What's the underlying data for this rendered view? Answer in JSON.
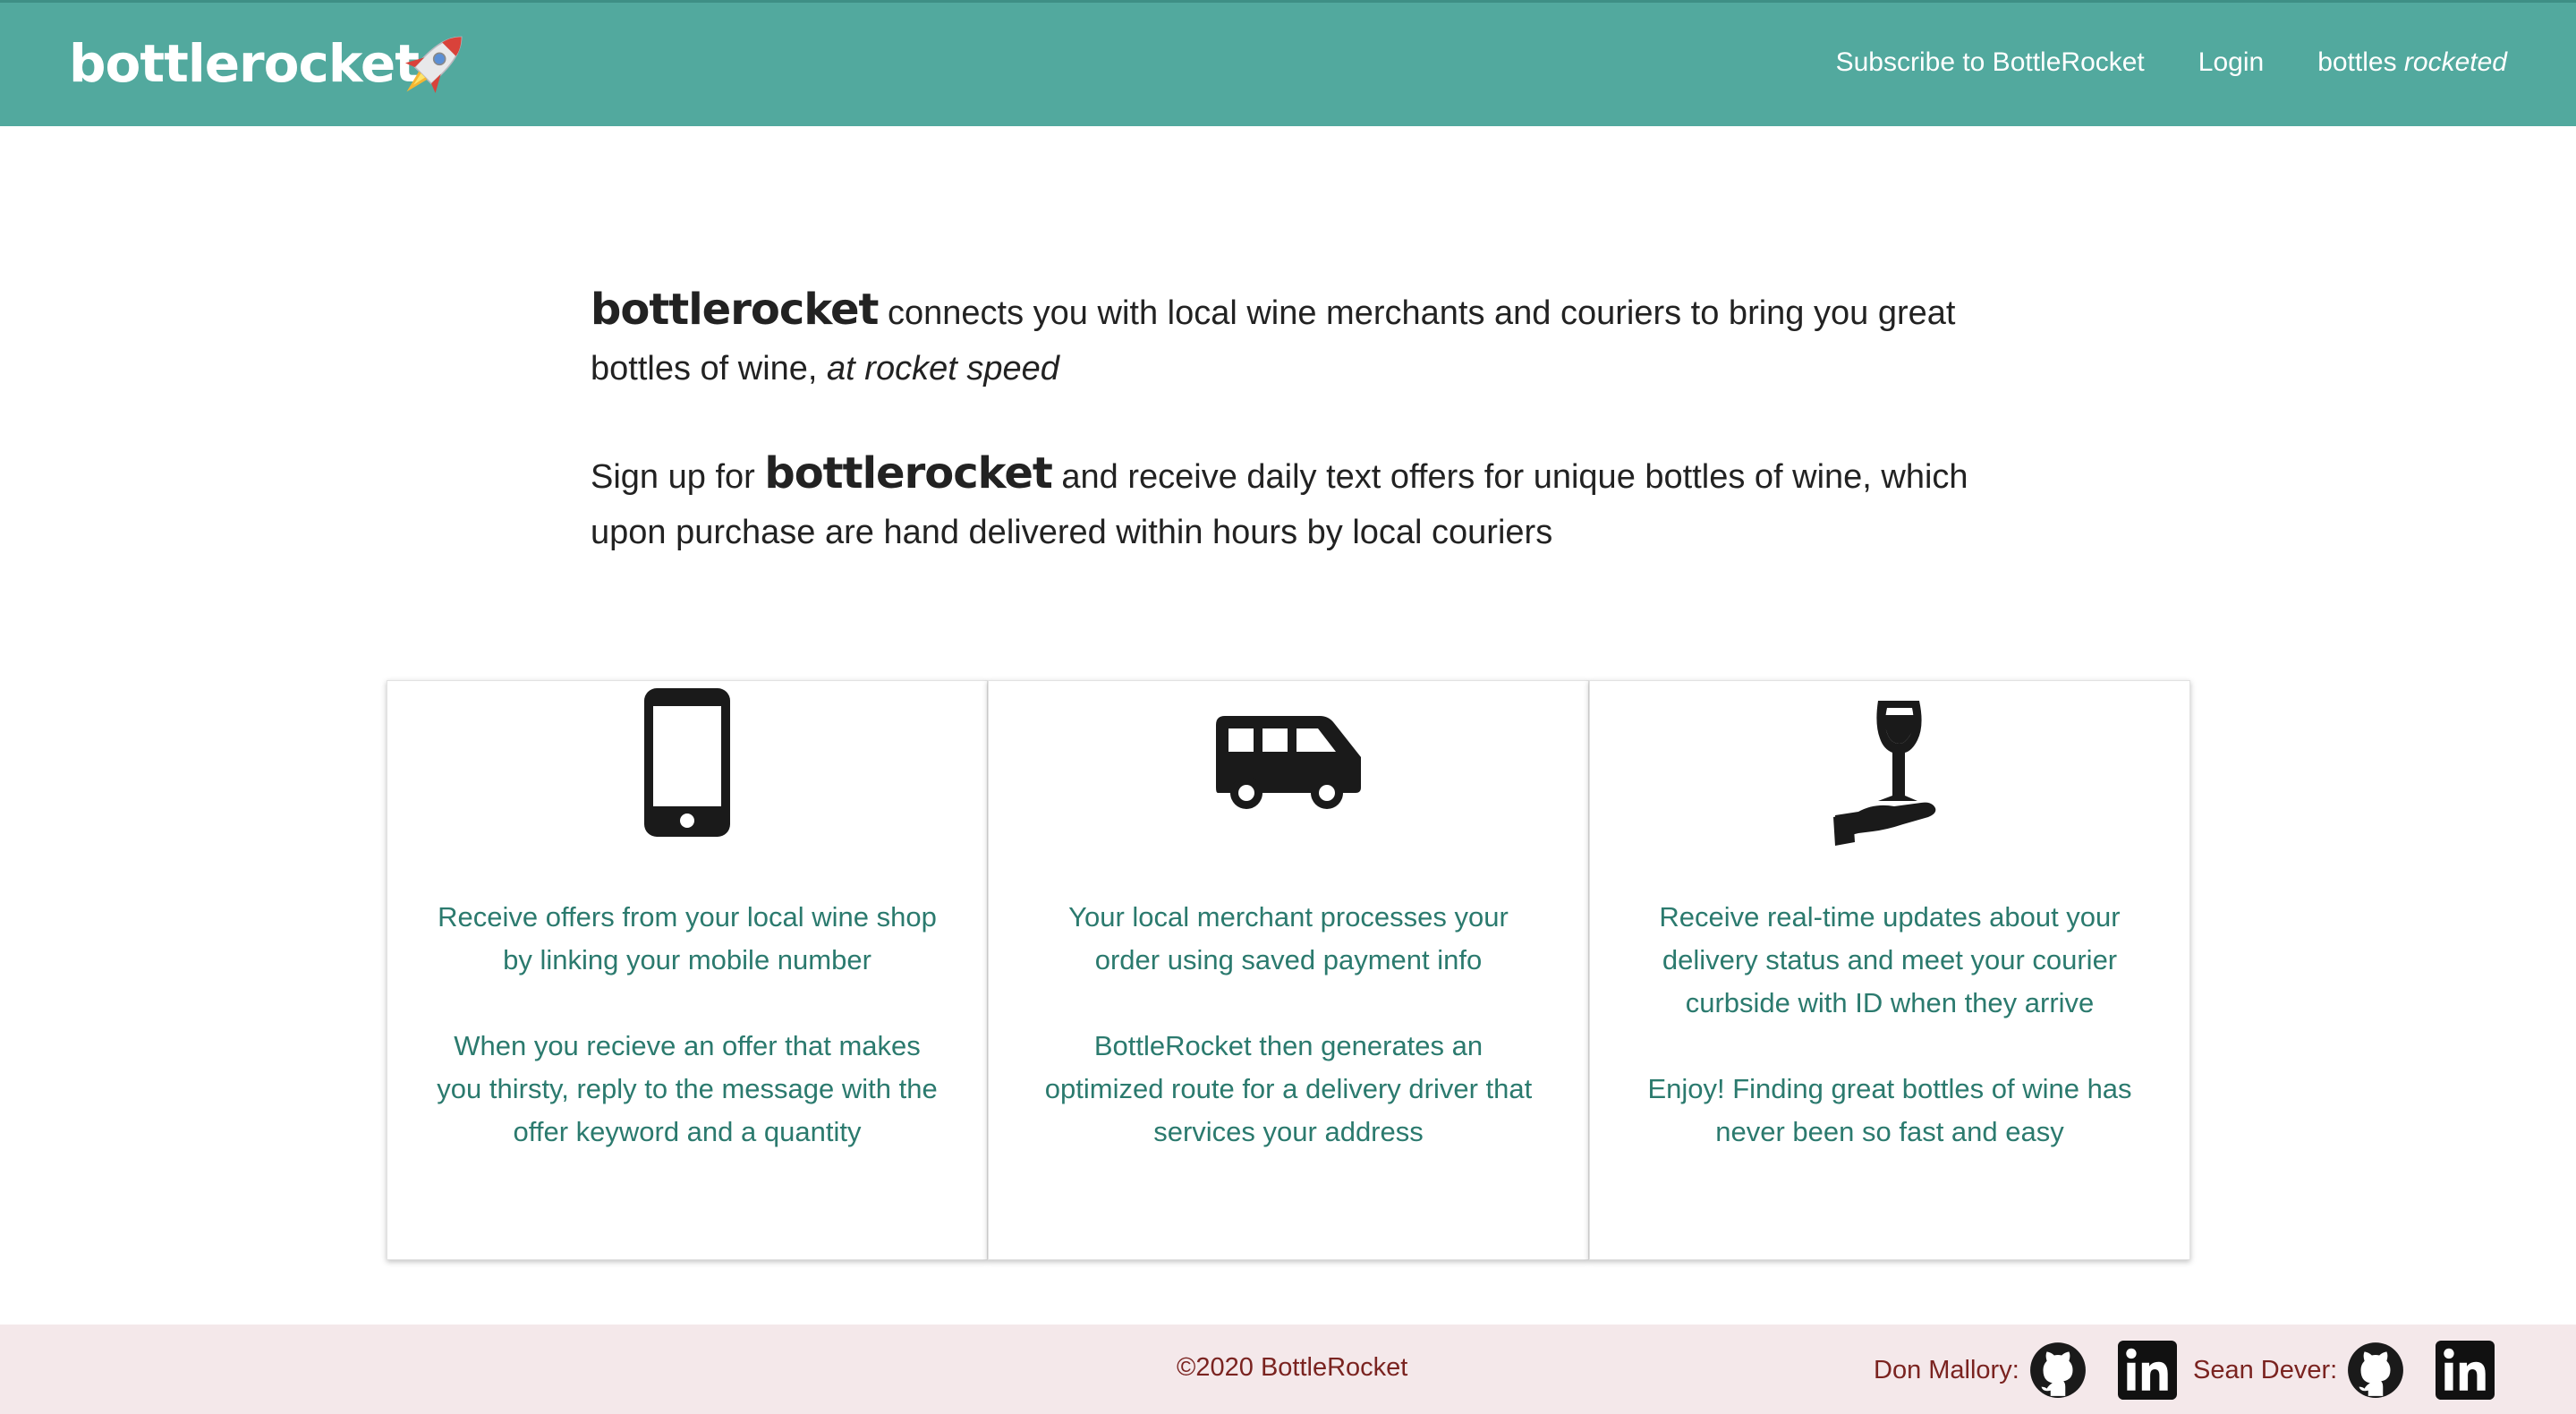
{
  "navbar": {
    "brand": "bottlerocket",
    "links": [
      {
        "label": "Subscribe to BottleRocket"
      },
      {
        "label": "Login"
      }
    ],
    "tagline_prefix": "bottles ",
    "tagline_emph": "rocketed",
    "colors": {
      "background": "#52a99e",
      "text": "#ffffff"
    }
  },
  "intro": {
    "p1_brand": "bottlerocket",
    "p1_text": " connects you with local wine merchants and couriers to bring you great bottles of wine, ",
    "p1_emph": "at rocket speed",
    "p2_prefix": "Sign up for ",
    "p2_brand": "bottlerocket",
    "p2_text": " and receive daily text offers for unique bottles of wine, which upon purchase are hand delivered within hours by local couriers"
  },
  "cards": [
    {
      "icon": "mobile-phone-icon",
      "p1": "Receive offers from your local wine shop by linking your mobile number",
      "p2": "When you recieve an offer that makes you thirsty, reply to the message with the offer keyword and a quantity"
    },
    {
      "icon": "delivery-van-icon",
      "p1": "Your local merchant processes your order using saved payment info",
      "p2": "BottleRocket then generates an optimized route for a delivery driver that services your address"
    },
    {
      "icon": "hand-wine-glass-icon",
      "p1": "Receive real-time updates about your delivery status and meet your courier curbside with ID when they arrive",
      "p2": "Enjoy! Finding great bottles of wine has never been so fast and easy"
    }
  ],
  "footer": {
    "copyright": "©2020 BottleRocket",
    "authors": [
      {
        "name": "Don Mallory:",
        "icons": [
          "github-icon",
          "linkedin-icon"
        ]
      },
      {
        "name": "Sean Dever:",
        "icons": [
          "github-icon",
          "linkedin-icon"
        ]
      }
    ],
    "colors": {
      "background": "#f4e8ea",
      "text": "#7a2320"
    }
  },
  "colors": {
    "card_text": "#2b7a6e"
  }
}
